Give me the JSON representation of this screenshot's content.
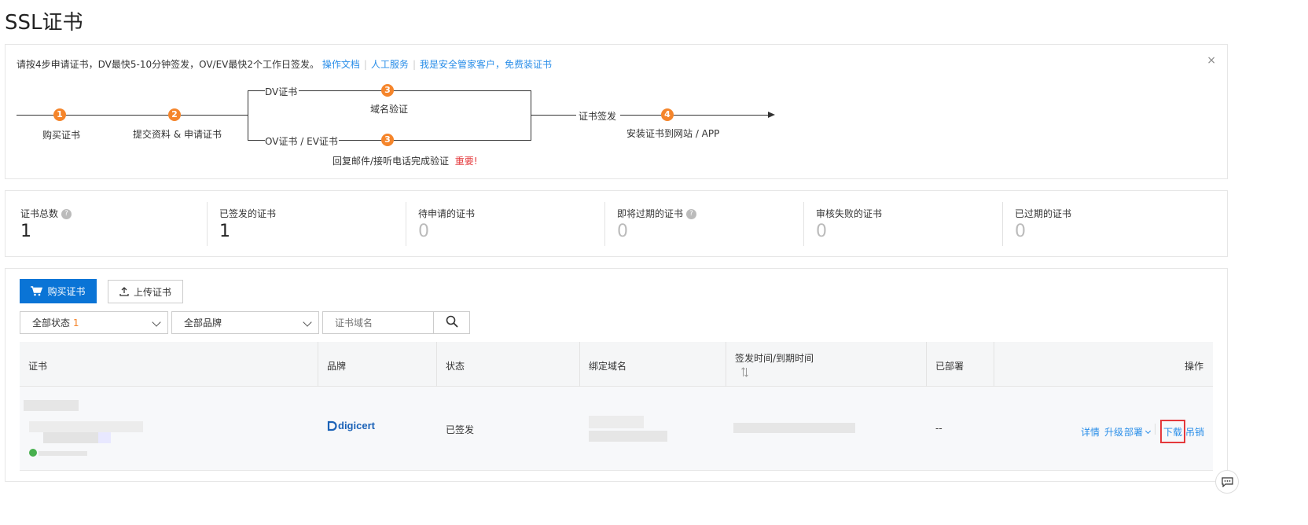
{
  "page": {
    "title": "SSL证书"
  },
  "notice": {
    "text": "请按4步申请证书，DV最快5-10分钟签发，OV/EV最快2个工作日签发。",
    "links": [
      "操作文档",
      "人工服务",
      "我是安全管家客户，免费装证书"
    ],
    "close": "×"
  },
  "flow": {
    "step1_num": "1",
    "step1_label": "购买证书",
    "step2_num": "2",
    "step2_label": "提交资料 & 申请证书",
    "dv_label": "DV证书",
    "step3_num": "3",
    "dv_step_label": "域名验证",
    "ov_label": "OV证书 / EV证书",
    "ov_step_label": "回复邮件/接听电话完成验证",
    "important": "重要!",
    "issue_label": "证书签发",
    "step4_num": "4",
    "step4_label": "安装证书到网站 / APP"
  },
  "stats": [
    {
      "label": "证书总数",
      "value": "1",
      "help": "?"
    },
    {
      "label": "已签发的证书",
      "value": "1"
    },
    {
      "label": "待申请的证书",
      "value": "0"
    },
    {
      "label": "即将过期的证书",
      "value": "0",
      "help": "?"
    },
    {
      "label": "审核失败的证书",
      "value": "0"
    },
    {
      "label": "已过期的证书",
      "value": "0"
    }
  ],
  "toolbar": {
    "buy_label": "购买证书",
    "upload_label": "上传证书"
  },
  "filters": {
    "status_label": "全部状态",
    "status_count": "1",
    "brand_label": "全部品牌",
    "search_placeholder": "证书域名"
  },
  "table": {
    "headers": [
      "证书",
      "品牌",
      "状态",
      "绑定域名",
      "签发时间/到期时间",
      "已部署",
      "操作"
    ],
    "row": {
      "brand": "digicert",
      "status": "已签发",
      "deployed": "--",
      "actions": [
        "详情",
        "升级",
        "部署",
        "下载",
        "吊销"
      ]
    }
  },
  "colors": {
    "accent": "#0a74d6",
    "link": "#2a8ee8",
    "step": "#f5852b",
    "important": "#e4393c"
  }
}
